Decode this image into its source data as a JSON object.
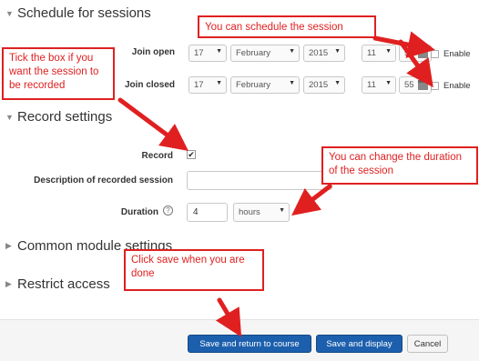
{
  "sections": {
    "schedule": "Schedule for sessions",
    "record": "Record settings",
    "common": "Common module settings",
    "restrict": "Restrict access"
  },
  "join_open": {
    "label": "Join open",
    "day": "17",
    "month": "February",
    "year": "2015",
    "hour": "11",
    "minute": "55",
    "enable": "Enable"
  },
  "join_closed": {
    "label": "Join closed",
    "day": "17",
    "month": "February",
    "year": "2015",
    "hour": "11",
    "minute": "55",
    "enable": "Enable"
  },
  "record": {
    "label": "Record",
    "checked": true,
    "description_label": "Description of recorded session",
    "description_value": "",
    "duration_label": "Duration",
    "duration_value": "4",
    "duration_unit": "hours"
  },
  "buttons": {
    "save_return": "Save and return to course",
    "save_display": "Save and display",
    "cancel": "Cancel"
  },
  "callouts": {
    "schedule": "You can schedule the session",
    "record": "Tick the box if you want the session to be recorded",
    "duration": "You can change the duration of the session",
    "save": "Click save when you are done"
  },
  "colors": {
    "annotation": "#e02020",
    "primary_button": "#1c5fad"
  }
}
